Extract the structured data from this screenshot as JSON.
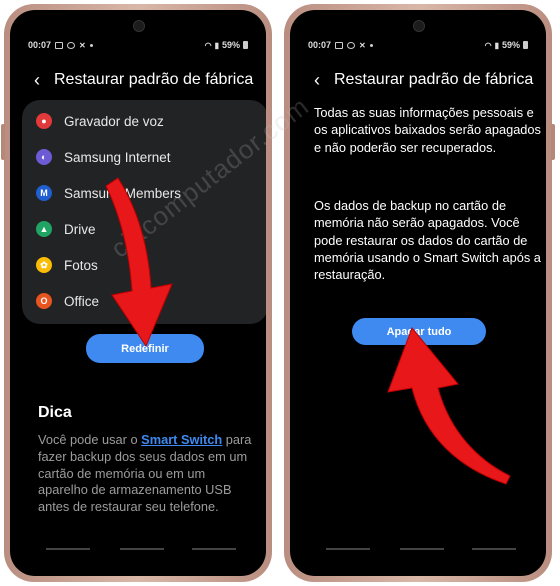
{
  "left_phone": {
    "status": {
      "time": "00:07",
      "battery": "59%"
    },
    "header": {
      "back_glyph": "‹",
      "title": "Restaurar padrão de fábrica"
    },
    "apps": [
      {
        "label": "Gravador de voz",
        "icon": "voice-recorder-icon",
        "color": "#e23a3a",
        "glyph": "●"
      },
      {
        "label": "Samsung Internet",
        "icon": "samsung-internet-icon",
        "color": "#6d5bd6",
        "glyph": "◐"
      },
      {
        "label": "Samsung Members",
        "icon": "samsung-members-icon",
        "color": "#1f5fd1",
        "glyph": "M"
      },
      {
        "label": "Drive",
        "icon": "google-drive-icon",
        "color": "#1fa463",
        "glyph": "▲"
      },
      {
        "label": "Fotos",
        "icon": "google-photos-icon",
        "color": "#fbbc05",
        "glyph": "✿"
      },
      {
        "label": "Office",
        "icon": "office-icon",
        "color": "#e8541f",
        "glyph": "O"
      }
    ],
    "reset_button": "Redefinir",
    "tip": {
      "heading": "Dica",
      "text_before": "Você pode usar o ",
      "link": "Smart Switch",
      "text_after": " para fazer backup dos seus dados em um cartão de memória ou em um aparelho de armazenamento USB antes de restaurar seu telefone."
    }
  },
  "right_phone": {
    "status": {
      "time": "00:07",
      "battery": "59%"
    },
    "header": {
      "back_glyph": "‹",
      "title": "Restaurar padrão de fábrica"
    },
    "paragraph1": "Todas as suas informações pessoais e os aplicativos baixados serão apagados e não poderão ser recuperados.",
    "paragraph2": "Os dados de backup no cartão de memória não serão apagados. Você pode restaurar os dados do cartão de memória usando o Smart Switch após a restauração.",
    "erase_button": "Apagar tudo"
  },
  "watermark": "ciacomputador.com",
  "colors": {
    "accent": "#3e8af0",
    "arrow": "#e8171a",
    "frame": "#c9a394"
  }
}
